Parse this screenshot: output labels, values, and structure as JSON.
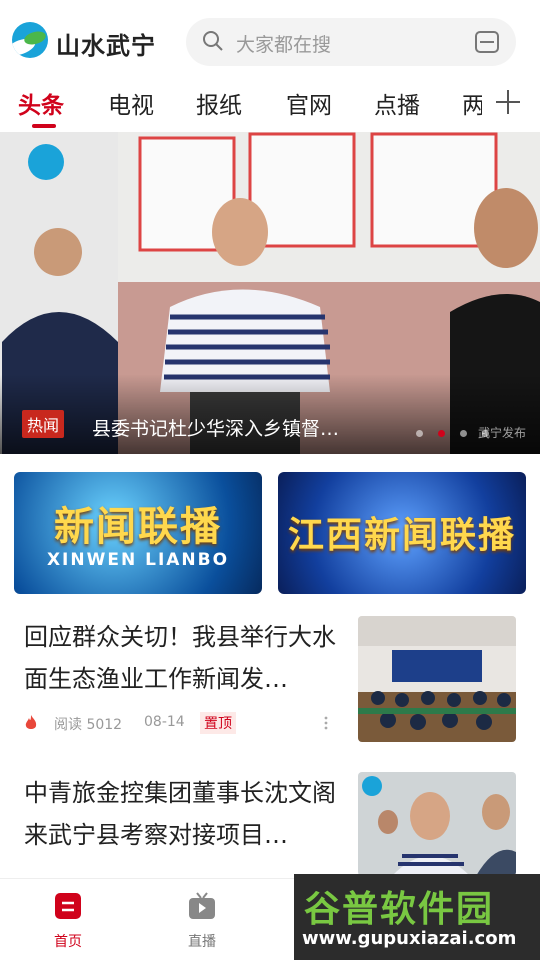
{
  "header": {
    "app_name": "山水武宁",
    "search_placeholder": "大家都在搜"
  },
  "tabs": [
    {
      "label": "头条",
      "active": true
    },
    {
      "label": "电视"
    },
    {
      "label": "报纸"
    },
    {
      "label": "官网"
    },
    {
      "label": "点播"
    },
    {
      "label": "两"
    }
  ],
  "banner": {
    "badge": "热闻",
    "title": "县委书记杜少华深入乡镇督…",
    "dots": 4,
    "active_dot": 2,
    "caption": "武宁发布"
  },
  "promos": [
    {
      "title": "新闻联播",
      "subtitle": "XINWEN LIANBO"
    },
    {
      "title": "江西新闻联播"
    }
  ],
  "news": [
    {
      "title": "回应群众关切！我县举行大水面生态渔业工作新闻发…",
      "reads_label": "阅读",
      "reads": "5012",
      "date": "08-14",
      "tag": "置顶"
    },
    {
      "title": "中青旅金控集团董事长沈文阁来武宁县考察对接项目…"
    }
  ],
  "bottom_nav": [
    {
      "label": "首页",
      "icon": "home-icon",
      "active": true
    },
    {
      "label": "直播",
      "icon": "tv-icon"
    }
  ],
  "site_watermark": {
    "name": "谷普软件园",
    "url": "www.gupuxiazai.com"
  },
  "colors": {
    "accent": "#d0021b"
  }
}
